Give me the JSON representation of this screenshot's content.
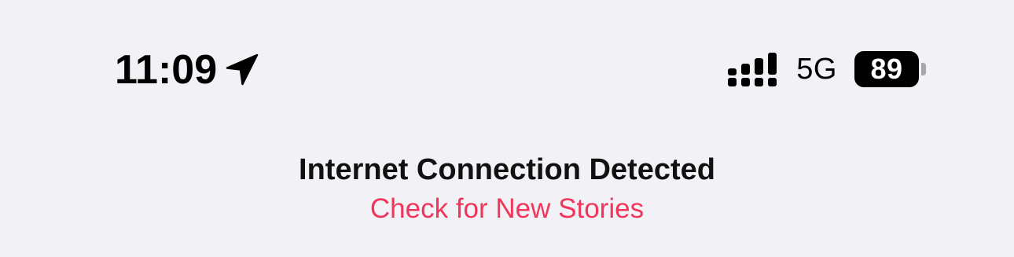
{
  "status_bar": {
    "time": "11:09",
    "location_icon": "location-arrow-icon",
    "signal_icon": "cellular-signal-icon",
    "network": "5G",
    "battery_level": "89",
    "battery_icon": "battery-icon"
  },
  "notice": {
    "title": "Internet Connection Detected",
    "action_label": "Check for New Stories",
    "action_color": "#f0365b"
  }
}
